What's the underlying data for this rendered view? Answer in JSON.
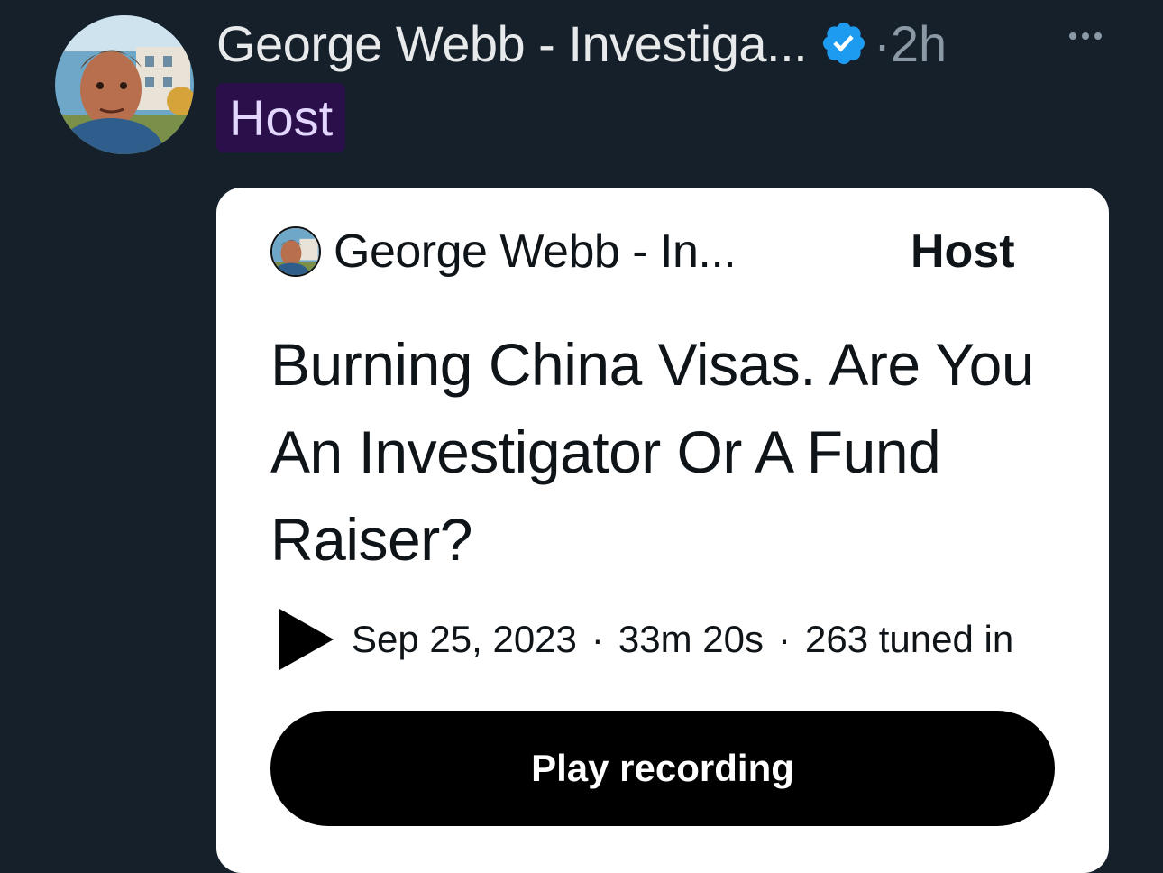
{
  "tweet": {
    "display_name": "George Webb - Investiga...",
    "separator": "·",
    "time": "2h",
    "role_badge": "Host"
  },
  "space_card": {
    "host_name": "George Webb - In...",
    "host_label": "Host",
    "title": "Burning China Visas. Are You An Investigator Or A Fund Raiser?",
    "date": "Sep 25, 2023",
    "duration": "33m 20s",
    "listeners": "263 tuned in",
    "meta_separator": "·",
    "play_button_label": "Play recording"
  },
  "icons": {
    "verified": "verified-badge-icon",
    "more": "more-options-icon",
    "play": "play-icon"
  },
  "colors": {
    "background": "#15202b",
    "verified_blue": "#1d9bf0",
    "badge_bg": "#2a0f4a",
    "badge_text": "#e3d7ff",
    "muted": "#8b98a5"
  }
}
